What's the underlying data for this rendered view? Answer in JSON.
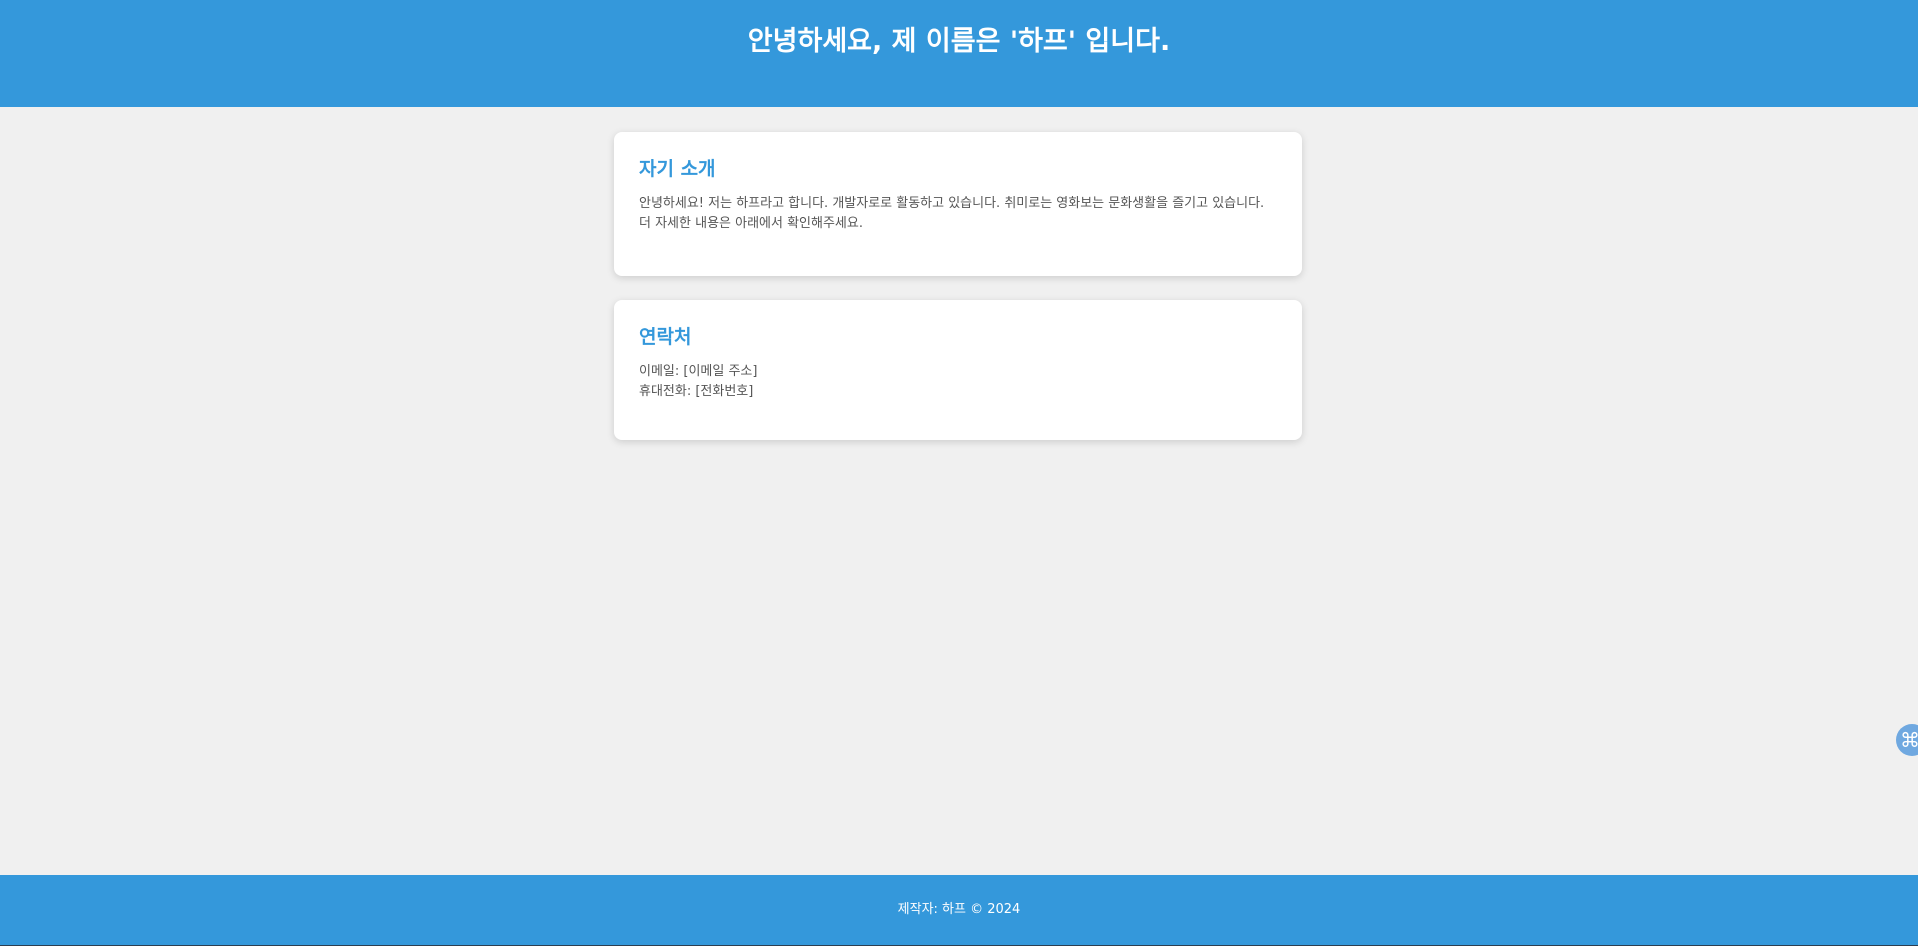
{
  "header": {
    "title": "안녕하세요, 제 이름은 '하프' 입니다."
  },
  "sections": {
    "intro": {
      "title": "자기 소개",
      "body": "안녕하세요! 저는 하프라고 합니다. 개발자로로 활동하고 있습니다. 취미로는 영화보는 문화생활을 즐기고 있습니다. 더 자세한 내용은 아래에서 확인해주세요."
    },
    "contact": {
      "title": "연락처",
      "email_line": "이메일: [이메일 주소]",
      "phone_line": "휴대전화: [전화번호]"
    }
  },
  "footer": {
    "text": "제작자: 하프 © 2024"
  },
  "widget": {
    "icon": "⌘",
    "icon_name": "command-icon"
  },
  "colors": {
    "primary": "#3498db",
    "background": "#f0f0f0",
    "card": "#ffffff",
    "text": "#555555"
  }
}
